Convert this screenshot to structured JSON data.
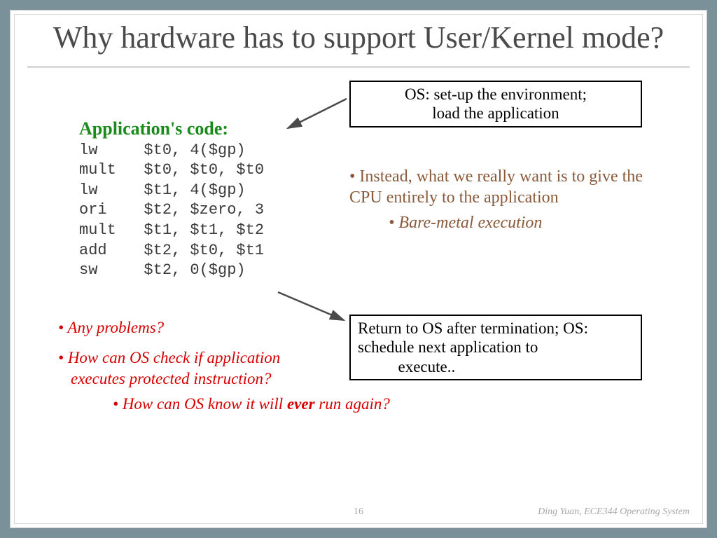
{
  "title": "Why hardware has to support User/Kernel mode?",
  "box_top": "OS: set-up the environment;\nload the application",
  "box_bottom": "Return to OS after termination; OS: schedule next application to execute..",
  "app_code_title": "Application's code:",
  "code": "lw     $t0, 4($gp)\nmult   $t0, $t0, $t0\nlw     $t1, 4($gp)\nori    $t2, $zero, 3\nmult   $t1, $t1, $t2\nadd    $t2, $t0, $t1\nsw     $t2, 0($gp)",
  "right_b1": "Instead, what we really want is to give the CPU entirely to the application",
  "right_b2": "Bare-metal execution",
  "q1": "Any problems?",
  "q2a": "How can OS check if application",
  "q2b": "executes protected instruction?",
  "q3a": "How can OS know it will ",
  "q3_ever": "ever",
  "q3b": " run again?",
  "page_num": "16",
  "author": "Ding Yuan, ECE344 Operating System"
}
